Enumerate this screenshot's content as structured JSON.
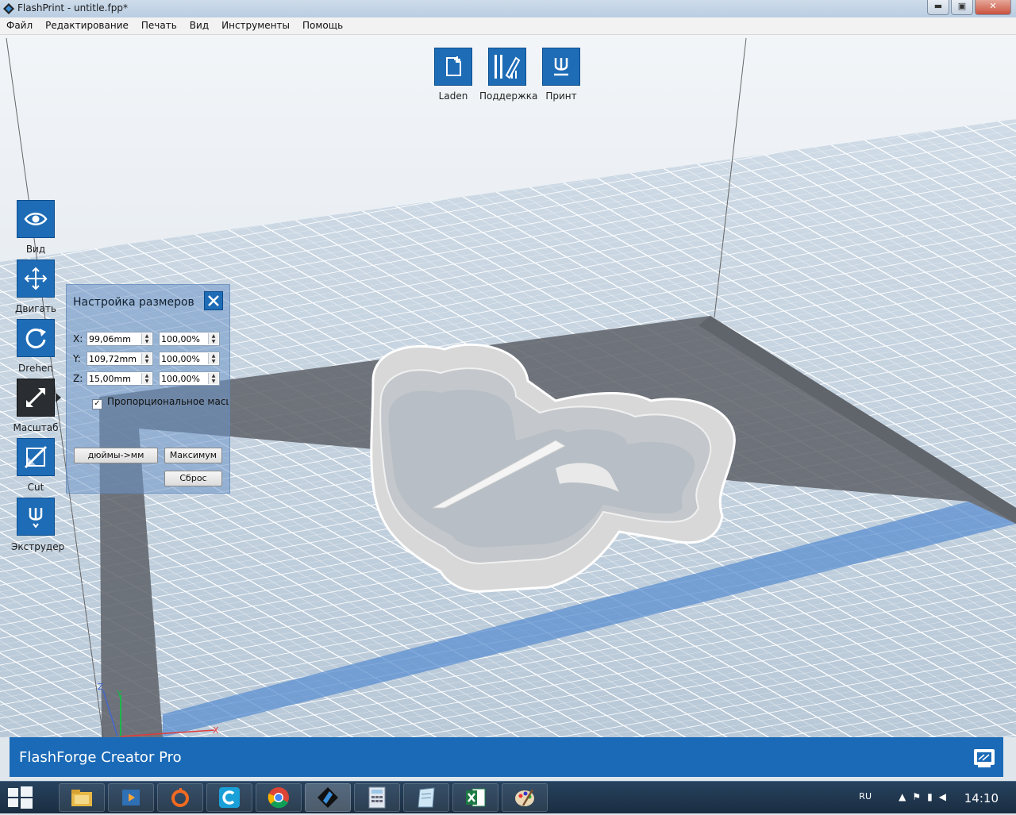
{
  "window": {
    "title": "FlashPrint - untitle.fpp*",
    "min": "▬",
    "max": "▣",
    "close": "✕"
  },
  "menu": [
    "Файл",
    "Редактирование",
    "Печать",
    "Вид",
    "Инструменты",
    "Помощь"
  ],
  "top_toolbar": {
    "load": "Laden",
    "support": "Поддержка",
    "print": "Принт"
  },
  "side_tools": [
    {
      "label": "Вид",
      "icon": "eye-icon"
    },
    {
      "label": "Двигать",
      "icon": "move-icon"
    },
    {
      "label": "Drehen",
      "icon": "rotate-icon"
    },
    {
      "label": "Масштаб",
      "icon": "scale-icon",
      "active": true
    },
    {
      "label": "Cut",
      "icon": "cut-icon"
    },
    {
      "label": "Экструдер",
      "icon": "extruder-icon"
    }
  ],
  "scale_panel": {
    "title": "Настройка размеров",
    "x_label": "X:",
    "x_mm": "99,06mm",
    "x_pct": "100,00%",
    "y_label": "Y:",
    "y_mm": "109,72mm",
    "y_pct": "100,00%",
    "z_label": "Z:",
    "z_mm": "15,00mm",
    "z_pct": "100,00%",
    "proportional": "Пропорциональное масш",
    "proportional_checked": true,
    "inches_to_mm": "дюймы->мм",
    "maximum": "Максимум",
    "reset": "Сброс"
  },
  "axes": {
    "z": "Z",
    "y": "Y",
    "x": "X"
  },
  "status": {
    "printer": "FlashForge Creator Pro"
  },
  "taskbar": {
    "lang": "RU",
    "time": "14:10",
    "apps": [
      "explorer-icon",
      "media-player-icon",
      "origin-icon",
      "ccleaner-icon",
      "chrome-icon",
      "flashprint-icon",
      "calculator-icon",
      "notepad-icon",
      "excel-icon",
      "paint-icon"
    ]
  },
  "colors": {
    "accent": "#1e6cb6",
    "active_tool": "#2a2d31",
    "build_plate_border": "#5e6268",
    "axis_highlight": "#5b8fd0"
  }
}
